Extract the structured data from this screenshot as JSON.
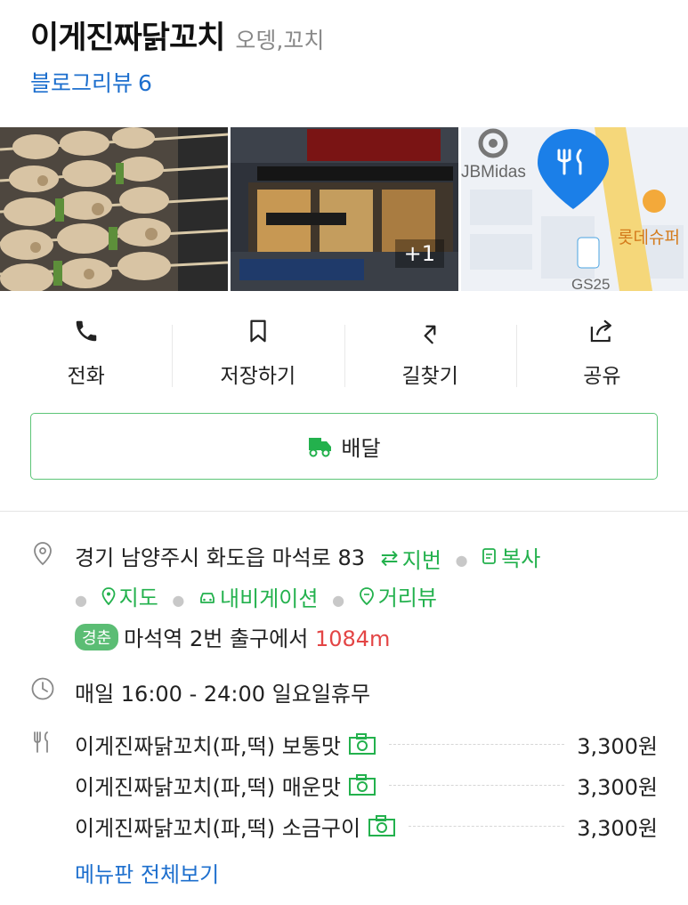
{
  "place": {
    "name": "이게진짜닭꼬치",
    "category": "오뎅,꼬치",
    "blog_review_label": "블로그리뷰",
    "blog_review_count": "6"
  },
  "photos": {
    "more_badge": "+1",
    "map_labels": {
      "jbmidas": "JBMidas",
      "lotte": "롯데슈퍼",
      "gs25": "GS25"
    }
  },
  "actions": [
    {
      "label": "전화",
      "icon": "phone-icon"
    },
    {
      "label": "저장하기",
      "icon": "bookmark-icon"
    },
    {
      "label": "길찾기",
      "icon": "directions-icon"
    },
    {
      "label": "공유",
      "icon": "share-icon"
    }
  ],
  "delivery": {
    "label": "배달",
    "icon": "delivery-icon"
  },
  "address": {
    "text": "경기 남양주시 화도읍 마석로 83",
    "jibun": "지번",
    "copy": "복사",
    "map": "지도",
    "navigation": "내비게이션",
    "street_view": "거리뷰"
  },
  "transit": {
    "line_badge": "경춘",
    "station": "마석역",
    "exit": "2번 출구에서",
    "distance": "1084m"
  },
  "hours": {
    "text": "매일 16:00 - 24:00 일요일휴무"
  },
  "menu": {
    "items": [
      {
        "name": "이게진짜닭꼬치(파,떡) 보통맛",
        "price": "3,300원"
      },
      {
        "name": "이게진짜닭꼬치(파,떡) 매운맛",
        "price": "3,300원"
      },
      {
        "name": "이게진짜닭꼬치(파,떡) 소금구이",
        "price": "3,300원"
      }
    ],
    "view_all": "메뉴판 전체보기"
  },
  "colors": {
    "accent_green": "#23b14d",
    "link_blue": "#1d6fce",
    "distance_red": "#e34545",
    "pin_blue": "#1b7fe8"
  }
}
